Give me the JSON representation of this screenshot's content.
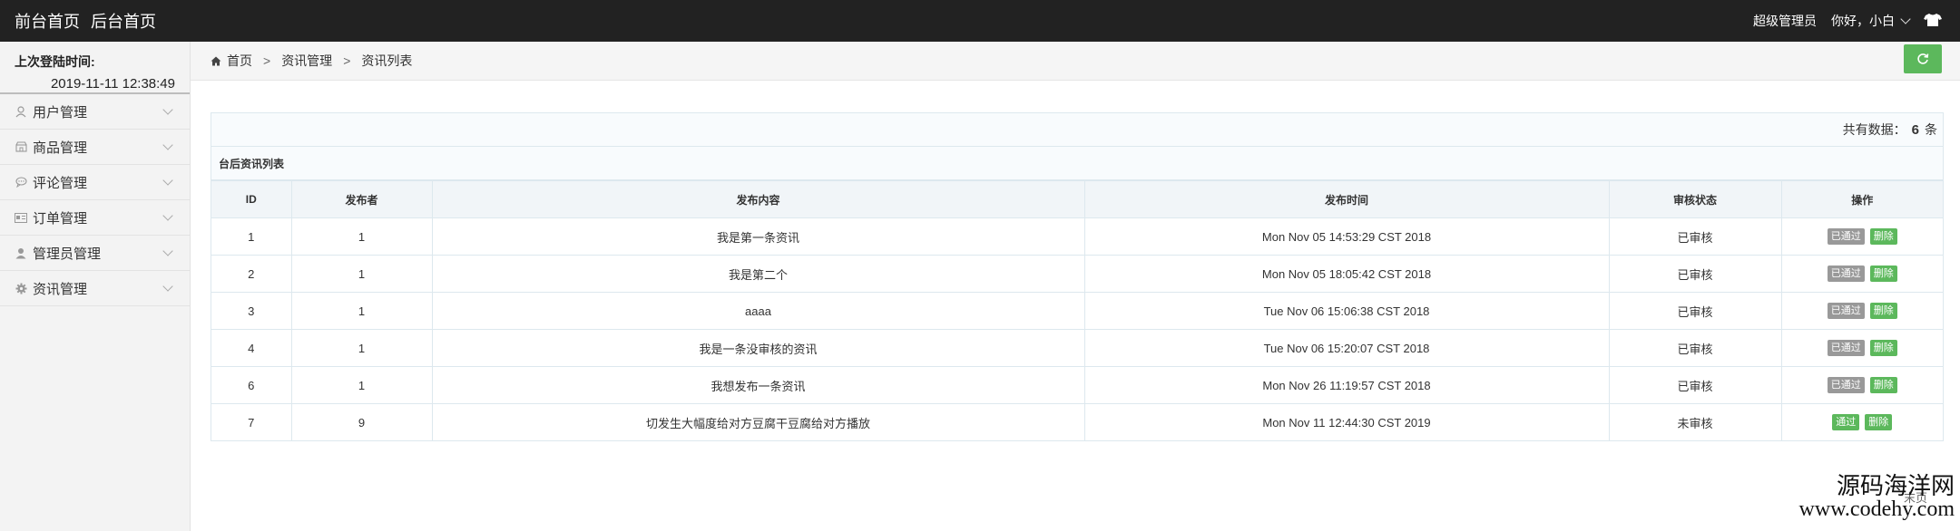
{
  "topbar": {
    "front_home": "前台首页",
    "back_home": "后台首页",
    "role": "超级管理员",
    "greeting": "你好，小白"
  },
  "sidebar": {
    "login_label": "上次登陆时间:",
    "login_time": "2019-11-11 12:38:49",
    "items": [
      {
        "label": "用户管理",
        "icon": "user-icon"
      },
      {
        "label": "商品管理",
        "icon": "shop-icon"
      },
      {
        "label": "评论管理",
        "icon": "comment-icon"
      },
      {
        "label": "订单管理",
        "icon": "order-icon"
      },
      {
        "label": "管理员管理",
        "icon": "admin-icon"
      },
      {
        "label": "资讯管理",
        "icon": "gear-icon"
      }
    ]
  },
  "breadcrumb": {
    "home": "首页",
    "level1": "资讯管理",
    "level2": "资讯列表",
    "sep": ">"
  },
  "summary": {
    "prefix": "共有数据：",
    "count": "6",
    "suffix": "条"
  },
  "table": {
    "title": "台后资讯列表",
    "headers": [
      "ID",
      "发布者",
      "发布内容",
      "发布时间",
      "审核状态",
      "操作"
    ],
    "rows": [
      {
        "id": "1",
        "publisher": "1",
        "content": "我是第一条资讯",
        "time": "Mon Nov 05 14:53:29 CST 2018",
        "status": "已审核",
        "approve": "已通过",
        "delete": "删除",
        "approved": true
      },
      {
        "id": "2",
        "publisher": "1",
        "content": "我是第二个",
        "time": "Mon Nov 05 18:05:42 CST 2018",
        "status": "已审核",
        "approve": "已通过",
        "delete": "删除",
        "approved": true
      },
      {
        "id": "3",
        "publisher": "1",
        "content": "aaaa",
        "time": "Tue Nov 06 15:06:38 CST 2018",
        "status": "已审核",
        "approve": "已通过",
        "delete": "删除",
        "approved": true
      },
      {
        "id": "4",
        "publisher": "1",
        "content": "我是一条没审核的资讯",
        "time": "Tue Nov 06 15:20:07 CST 2018",
        "status": "已审核",
        "approve": "已通过",
        "delete": "删除",
        "approved": true
      },
      {
        "id": "6",
        "publisher": "1",
        "content": "我想发布一条资讯",
        "time": "Mon Nov 26 11:19:57 CST 2018",
        "status": "已审核",
        "approve": "已通过",
        "delete": "删除",
        "approved": true
      },
      {
        "id": "7",
        "publisher": "9",
        "content": "切发生大幅度给对方豆腐干豆腐给对方播放",
        "time": "Mon Nov 11 12:44:30 CST 2019",
        "status": "未审核",
        "approve": "通过",
        "delete": "删除",
        "approved": false
      }
    ]
  },
  "pagination": {
    "last_page": "末页"
  },
  "watermark": {
    "cn": "源码海洋网",
    "url": "www.codehy.com"
  },
  "colors": {
    "topbar": "#222222",
    "success": "#5cb85c",
    "muted": "#999999"
  }
}
